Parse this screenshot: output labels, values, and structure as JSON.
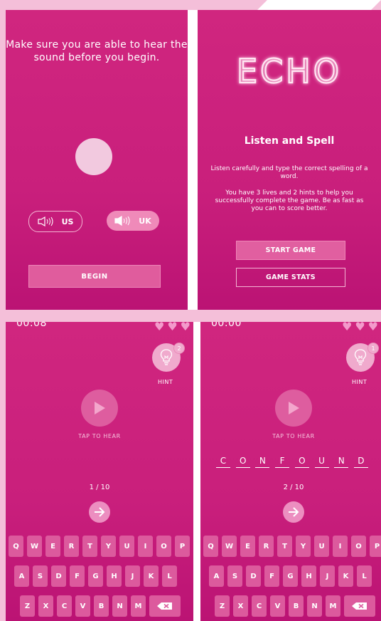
{
  "screen1": {
    "instruction": "Make sure you are able to hear the sound before you begin.",
    "us_label": "US",
    "uk_label": "UK",
    "begin_label": "BEGIN"
  },
  "screen2": {
    "logo_text": "ECHO",
    "subtitle": "Listen and Spell",
    "desc1": "Listen carefully and type the correct spelling of a word.",
    "desc2": "You have 3 lives and 2 hints to help you successfully complete the game. Be as fast as you can to score better.",
    "start_label": "START GAME",
    "stats_label": "GAME STATS"
  },
  "screen3": {
    "timer": "00:08",
    "hint_count": "2",
    "hint_label": "HINT",
    "tap_label": "TAP TO HEAR",
    "progress": "1 / 10"
  },
  "screen4": {
    "timer": "00:00",
    "hint_count": "1",
    "hint_label": "HINT",
    "tap_label": "TAP TO HEAR",
    "letters": [
      "C",
      "O",
      "N",
      "F",
      "O",
      "U",
      "N",
      "D"
    ],
    "progress": "2 / 10"
  },
  "keyboard": {
    "row1": [
      "Q",
      "W",
      "E",
      "R",
      "T",
      "Y",
      "U",
      "I",
      "O",
      "P"
    ],
    "row2": [
      "A",
      "S",
      "D",
      "F",
      "G",
      "H",
      "J",
      "K",
      "L"
    ],
    "row3": [
      "Z",
      "X",
      "C",
      "V",
      "B",
      "N",
      "M"
    ]
  },
  "icons": {
    "speaker": "speaker-icon",
    "lightbulb": "lightbulb-icon",
    "play": "play-icon",
    "arrow": "arrow-right-icon",
    "backspace": "backspace-icon",
    "heart": "heart-icon"
  },
  "colors": {
    "background": "#f4bfd9",
    "panel": "#c91f7c",
    "accent": "#ef8ab9"
  }
}
